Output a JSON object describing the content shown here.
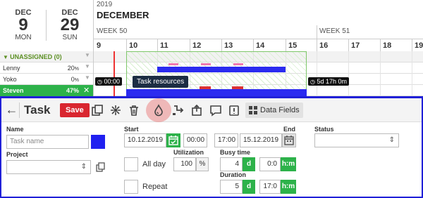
{
  "range": {
    "start": {
      "month": "DEC",
      "day": "9",
      "weekday": "MON"
    },
    "end": {
      "month": "DEC",
      "day": "29",
      "weekday": "SUN"
    }
  },
  "timeline": {
    "year": "2019",
    "month": "DECEMBER",
    "weeks": [
      "WEEK 50",
      "WEEK 51"
    ],
    "days": [
      "9",
      "10",
      "11",
      "12",
      "13",
      "14",
      "15",
      "16",
      "17",
      "18",
      "19"
    ]
  },
  "resources": [
    {
      "name": "UNASSIGNED (0)",
      "percent": ""
    },
    {
      "name": "Lenny",
      "percent": "20"
    },
    {
      "name": "Yoko",
      "percent": "0"
    },
    {
      "name": "Steven",
      "percent": "47"
    }
  ],
  "percent_sign": "%",
  "timeline_labels": {
    "start_time": "00:00",
    "duration_left": "5d 17h 0m"
  },
  "tooltip": "Task resources",
  "toolbar": {
    "title": "Task",
    "save_label": "Save",
    "data_fields_label": "Data Fields"
  },
  "form": {
    "name_label": "Name",
    "name_placeholder": "Task name",
    "color": "#2020f0",
    "project_label": "Project",
    "start_label": "Start",
    "start_date": "10.12.2019",
    "start_time": "00:00",
    "end_label": "End",
    "end_time": "17:00",
    "end_date": "15.12.2019",
    "status_label": "Status",
    "utilization_label": "Utilization",
    "utilization_value": "100",
    "utilization_unit": "%",
    "all_day_label": "All day",
    "repeat_label": "Repeat",
    "busy_label": "Busy time",
    "busy_days": "4",
    "busy_days_unit": "d",
    "busy_hm": "0:0",
    "busy_hm_unit": "h:m",
    "duration_label": "Duration",
    "duration_days": "5",
    "duration_days_unit": "d",
    "duration_hm": "17:0",
    "duration_hm_unit": "h:m"
  },
  "colors": {
    "accent_green": "#2db24a",
    "task_bar": "#2b2bf0",
    "save_red": "#d9262f",
    "today_line": "#e33333"
  }
}
